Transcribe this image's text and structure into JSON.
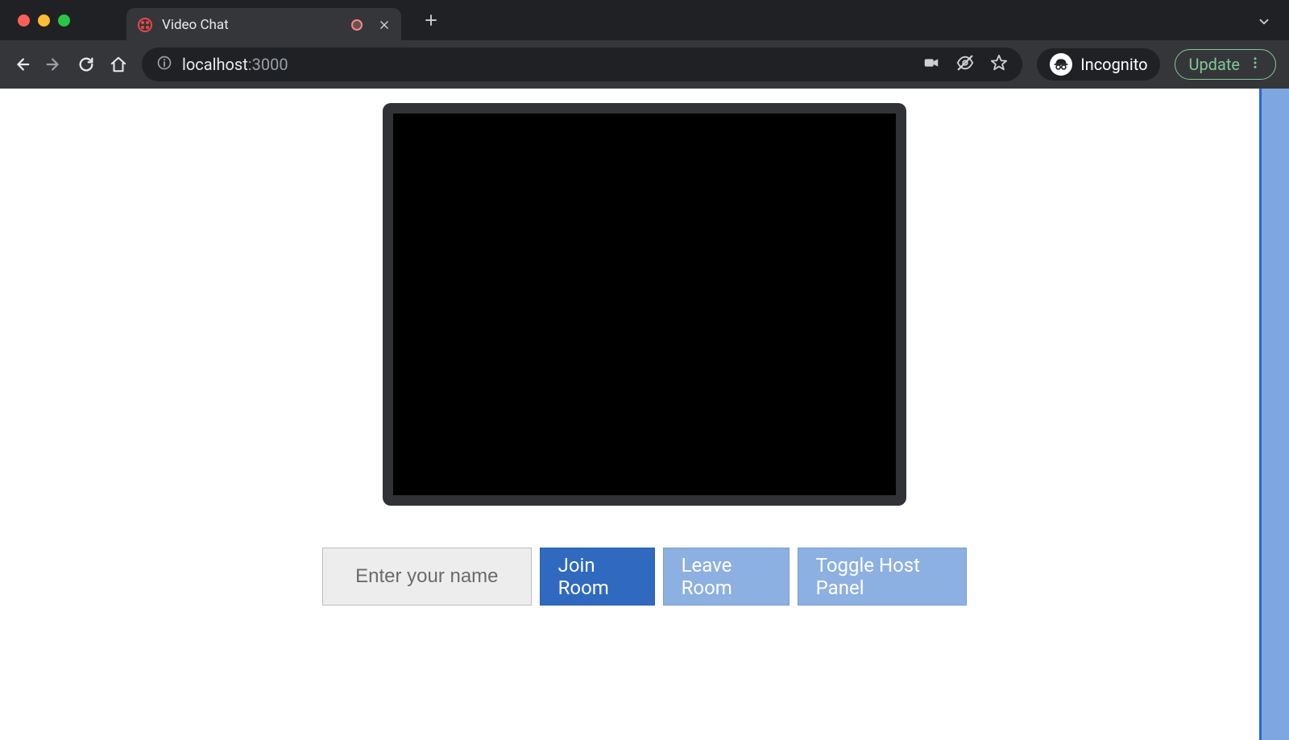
{
  "browser": {
    "tab_title": "Video Chat",
    "url_host": "localhost",
    "url_port": ":3000",
    "incognito_label": "Incognito",
    "update_label": "Update"
  },
  "page": {
    "name_input": {
      "placeholder": "Enter your name",
      "value": ""
    },
    "buttons": {
      "join": "Join Room",
      "leave": "Leave Room",
      "toggle_host": "Toggle Host Panel"
    }
  }
}
